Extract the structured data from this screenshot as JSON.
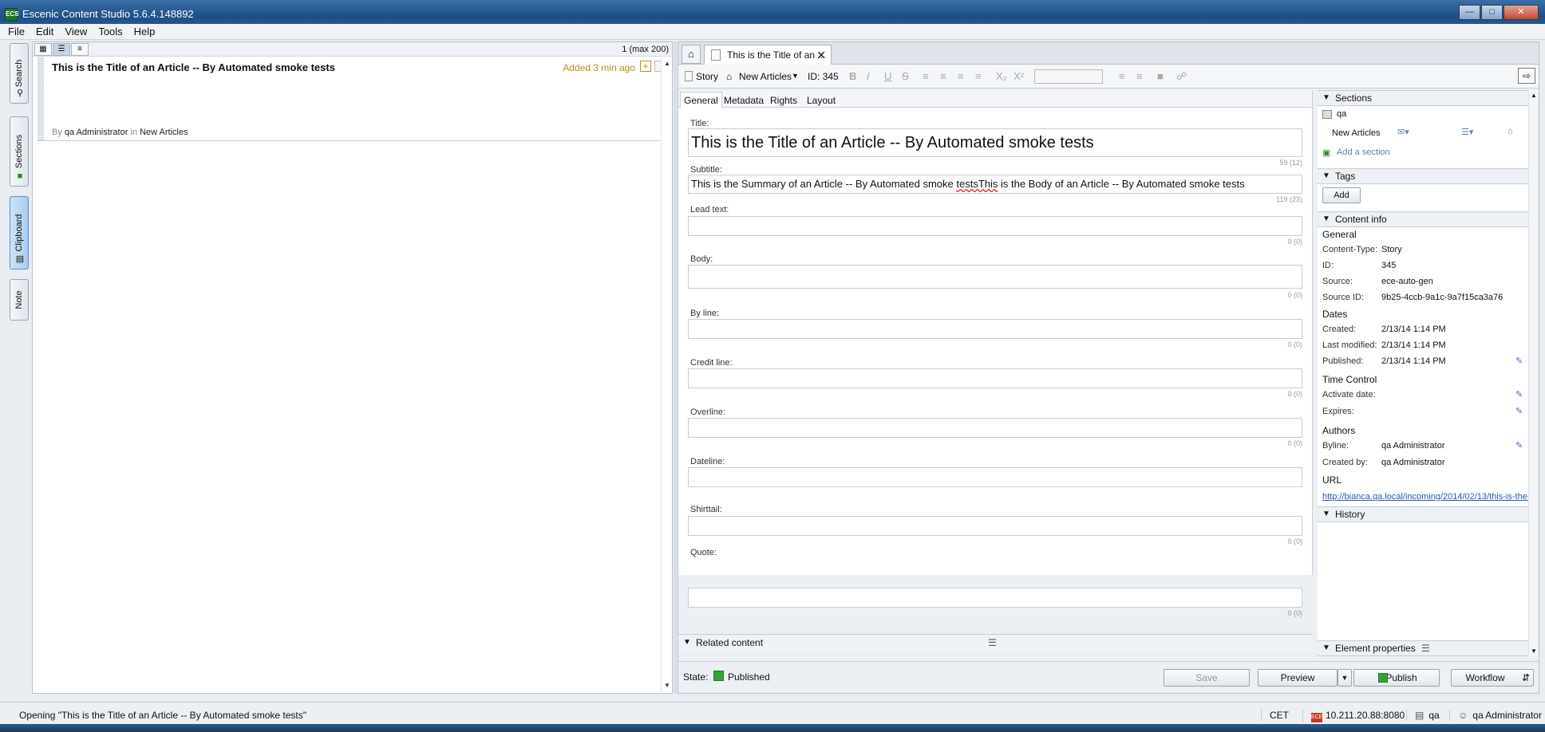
{
  "window": {
    "title": "Escenic Content Studio 5.6.4.148892",
    "app_icon": "ECS",
    "controls": [
      "minimize",
      "maximize",
      "close"
    ]
  },
  "menu": [
    "File",
    "Edit",
    "View",
    "Tools",
    "Help"
  ],
  "side_tabs": [
    {
      "label": "Search",
      "icon": "search-icon"
    },
    {
      "label": "Sections",
      "icon": "sections-icon"
    },
    {
      "label": "Clipboard",
      "icon": "clipboard-icon"
    },
    {
      "label": "Note",
      "icon": ""
    }
  ],
  "list": {
    "count_label": "1 (max 200)",
    "items": [
      {
        "title": "This is the Title of an Article -- By Automated smoke tests",
        "added": "Added 3 min ago",
        "by_prefix": "By",
        "author": "qa Administrator",
        "in_word": "in",
        "section": "New Articles"
      }
    ]
  },
  "doc_tab": {
    "label": "This is the Title of an ..."
  },
  "editor_toolbar": {
    "type": "Story",
    "section": "New Articles",
    "id_label": "ID: 345",
    "format_buttons": [
      "B",
      "I",
      "U",
      "S"
    ]
  },
  "sub_tabs": [
    "General",
    "Metadata",
    "Rights",
    "Layout"
  ],
  "fields": [
    {
      "label": "Title:",
      "value": "This is the Title of an Article -- By Automated smoke tests",
      "count": "59 (12)"
    },
    {
      "label": "Subtitle:",
      "value_a": "This is the Summary of an Article -- By Automated smoke ",
      "value_b": "testsThis",
      "value_c": " is the Body of an Article -- By Automated smoke tests",
      "count": "119 (23)"
    },
    {
      "label": "Lead text:",
      "count": "0 (0)"
    },
    {
      "label": "Body:",
      "count": "0 (0)"
    },
    {
      "label": "By line:",
      "count": "0 (0)"
    },
    {
      "label": "Credit line:",
      "count": "0 (0)"
    },
    {
      "label": "Overline:",
      "count": "0 (0)"
    },
    {
      "label": "Dateline:",
      "count": ""
    },
    {
      "label": "Shirttail:",
      "count": "0 (0)"
    },
    {
      "label": "Quote:",
      "count": "0 (0)"
    }
  ],
  "related_content": "Related content",
  "info_panel": {
    "sections_header": "Sections",
    "publication": "qa",
    "home_section": "New Articles",
    "add_section": "Add a section",
    "tags_header": "Tags",
    "tags_add": "Add",
    "content_info_header": "Content info",
    "general_heading": "General",
    "general": [
      {
        "key": "Content-Type:",
        "value": "Story"
      },
      {
        "key": "ID:",
        "value": "345"
      },
      {
        "key": "Source:",
        "value": "ece-auto-gen"
      },
      {
        "key": "Source ID:",
        "value": "9b25-4ccb-9a1c-9a7f15ca3a76"
      }
    ],
    "dates_heading": "Dates",
    "dates": [
      {
        "key": "Created:",
        "value": "2/13/14 1:14 PM"
      },
      {
        "key": "Last modified:",
        "value": "2/13/14 1:14 PM"
      },
      {
        "key": "Published:",
        "value": "2/13/14 1:14 PM"
      }
    ],
    "time_control_heading": "Time Control",
    "time_control": [
      {
        "key": "Activate date:",
        "value": ""
      },
      {
        "key": "Expires:",
        "value": ""
      }
    ],
    "authors_heading": "Authors",
    "authors": [
      {
        "key": "Byline:",
        "value": "qa Administrator"
      },
      {
        "key": "Created by:",
        "value": "qa Administrator"
      }
    ],
    "url_heading": "URL",
    "url": "http://bianca.qa.local/incoming/2014/02/13/this-is-the-",
    "history_header": "History",
    "element_properties_header": "Element properties"
  },
  "state": {
    "label": "State:",
    "value": "Published",
    "color": "#31a534"
  },
  "buttons": {
    "save": "Save",
    "preview": "Preview",
    "publish": "Publish",
    "workflow": "Workflow"
  },
  "statusbar": {
    "message": "Opening \"This is the Title of an Article -- By Automated smoke tests\"",
    "timezone": "CET",
    "server": "10.211.20.88:8080",
    "publication": "qa",
    "user": "qa Administrator"
  }
}
